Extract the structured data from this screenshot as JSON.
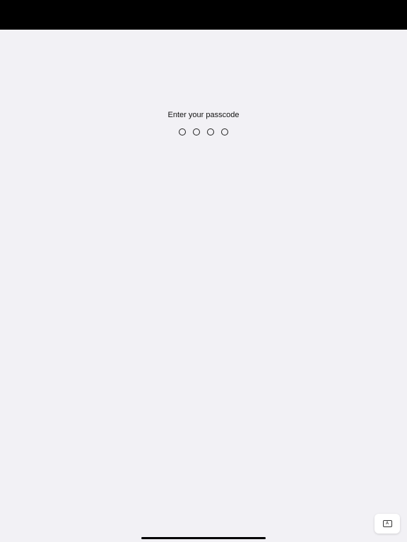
{
  "status_bar": {
    "color": "#000000"
  },
  "passcode": {
    "prompt": "Enter your passcode",
    "digit_count": 4,
    "entered_count": 0
  },
  "keyboard_toggle": {
    "icon": "keyboard-icon",
    "glyph": "A"
  },
  "colors": {
    "background": "#f2f1f5",
    "text": "#111111"
  }
}
